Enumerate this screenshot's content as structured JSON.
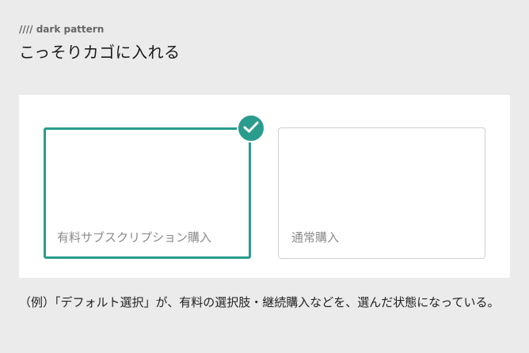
{
  "header": {
    "kicker": "//// dark pattern",
    "title": "こっそりカゴに入れる"
  },
  "options": [
    {
      "label": "有料サブスクリプション購入",
      "selected": true
    },
    {
      "label": "通常購入",
      "selected": false
    }
  ],
  "icons": {
    "selected": "check-circle-icon"
  },
  "colors": {
    "accent": "#2a9c8e",
    "background": "#ebebeb",
    "panel": "#ffffff"
  },
  "caption": "（例）「デフォルト選択」が、有料の選択肢・継続購入などを、選んだ状態になっている。"
}
